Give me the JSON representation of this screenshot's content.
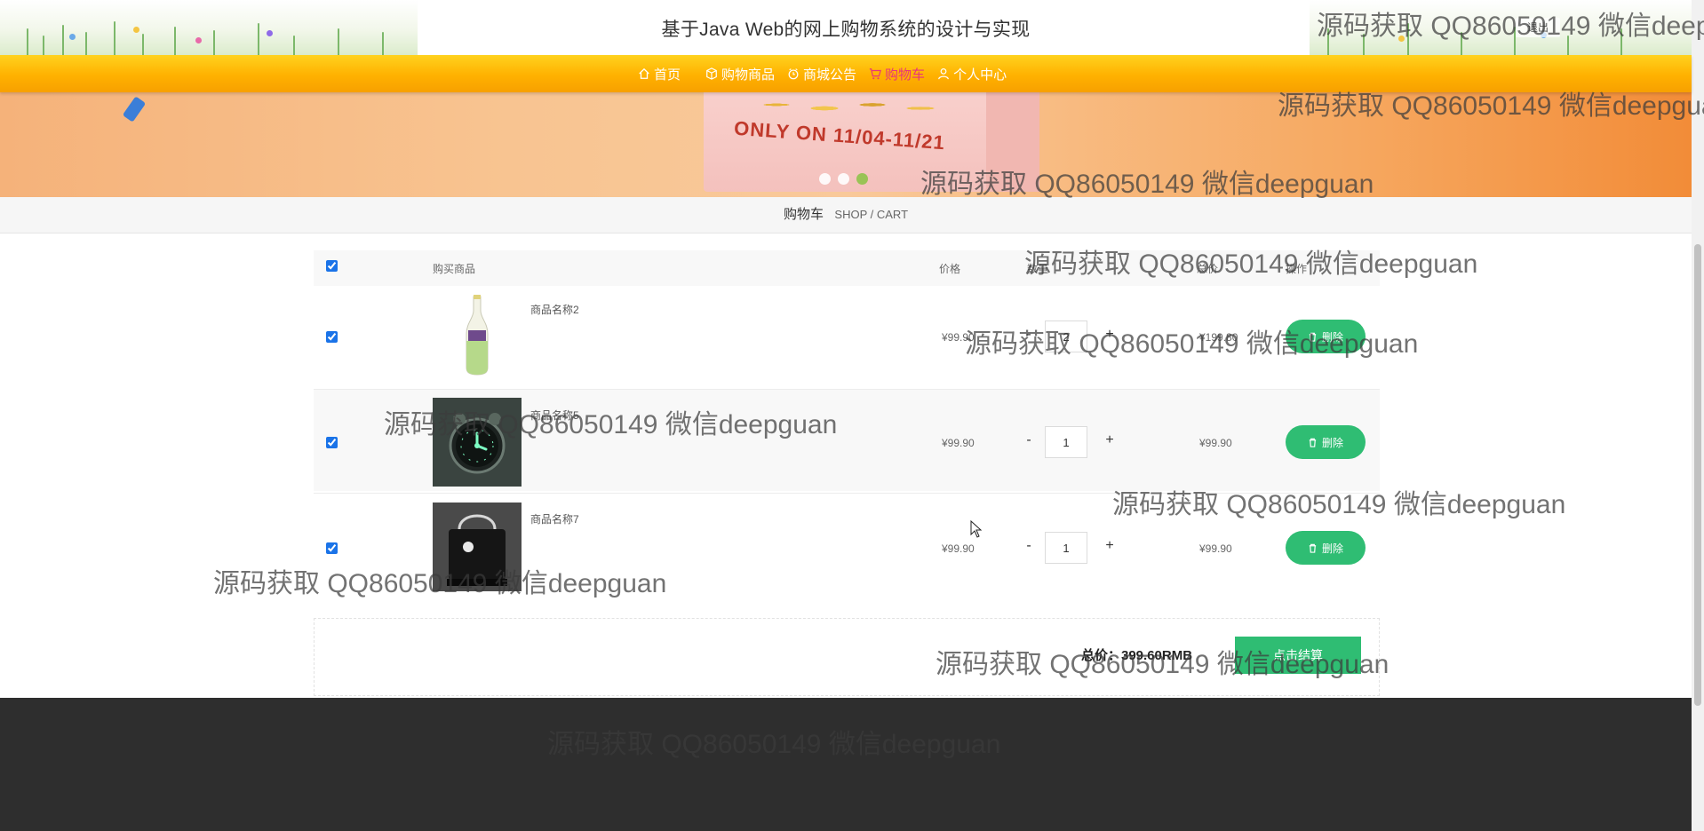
{
  "header": {
    "title": "基于Java Web的网上购物系统的设计与实现",
    "logout_label": "退出"
  },
  "nav": {
    "items": [
      {
        "label": "首页",
        "icon": "home-icon",
        "active": false
      },
      {
        "label": "购物商品",
        "icon": "box-icon",
        "active": false
      },
      {
        "label": "商城公告",
        "icon": "clock-icon",
        "active": false
      },
      {
        "label": "购物车",
        "icon": "cart-icon",
        "active": true
      },
      {
        "label": "个人中心",
        "icon": "user-icon",
        "active": false
      }
    ]
  },
  "banner": {
    "text": "ONLY ON 11/04-11/21",
    "active_slide": 3,
    "slide_count": 3
  },
  "breadcrumb": {
    "title": "购物车",
    "subtitle": "SHOP / CART"
  },
  "cart": {
    "columns": {
      "product": "购买商品",
      "price": "价格",
      "quantity": "数量",
      "total": "总价",
      "action": "操作"
    },
    "rows": [
      {
        "name": "商品名称2",
        "price": "¥99.90",
        "quantity": "2",
        "total": "¥199.80",
        "checked": true,
        "image": "drink-bottle"
      },
      {
        "name": "商品名称5",
        "price": "¥99.90",
        "quantity": "1",
        "total": "¥99.90",
        "checked": true,
        "image": "alarm-clock"
      },
      {
        "name": "商品名称7",
        "price": "¥99.90",
        "quantity": "1",
        "total": "¥99.90",
        "checked": true,
        "image": "handbag"
      }
    ],
    "minus_label": "-",
    "plus_label": "+",
    "delete_label": "删除",
    "summary_label": "总价：399.60RMB",
    "checkout_label": "点击结算"
  },
  "watermark": "源码获取 QQ86050149 微信deepguan",
  "colors": {
    "nav_active": "#e8357a",
    "accent_green": "#2fbd73",
    "nav_yellow": "#ffb100",
    "footer": "#2e2e2e"
  }
}
